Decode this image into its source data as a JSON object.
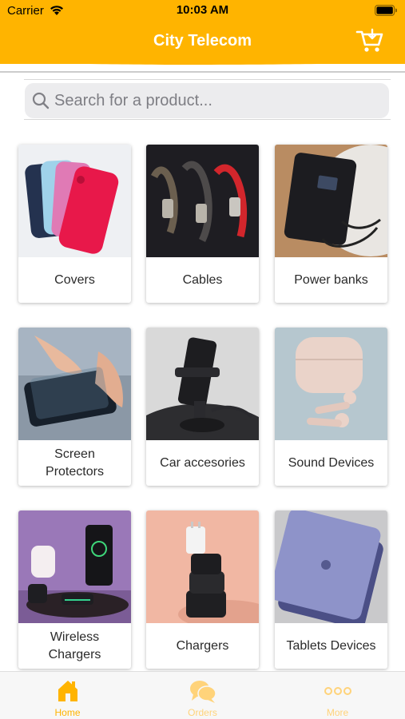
{
  "status_bar": {
    "carrier": "Carrier",
    "time": "10:03 AM"
  },
  "header": {
    "title": "City Telecom",
    "cart_icon": "shopping-cart-icon"
  },
  "search": {
    "placeholder": "Search for a product...",
    "value": ""
  },
  "categories": [
    {
      "label": "Covers",
      "image": "phone-covers"
    },
    {
      "label": "Cables",
      "image": "charging-cables"
    },
    {
      "label": "Power banks",
      "image": "power-bank"
    },
    {
      "label": "Screen\nProtectors",
      "image": "screen-protector"
    },
    {
      "label": "Car accesories",
      "image": "car-phone-holder"
    },
    {
      "label": "Sound Devices",
      "image": "wireless-earbuds"
    },
    {
      "label": "Wireless\nChargers",
      "image": "wireless-charging-dock"
    },
    {
      "label": "Chargers",
      "image": "wall-chargers"
    },
    {
      "label": "Tablets Devices",
      "image": "tablet"
    }
  ],
  "tabs": [
    {
      "label": "Home",
      "icon": "home-icon",
      "active": true
    },
    {
      "label": "Orders",
      "icon": "chat-bubbles-icon",
      "active": false
    },
    {
      "label": "More",
      "icon": "more-dots-icon",
      "active": false
    }
  ],
  "colors": {
    "accent": "#FFB400",
    "accent_light": "#FFD37A",
    "background": "#FFFFFF",
    "search_field": "#ECECEE"
  }
}
